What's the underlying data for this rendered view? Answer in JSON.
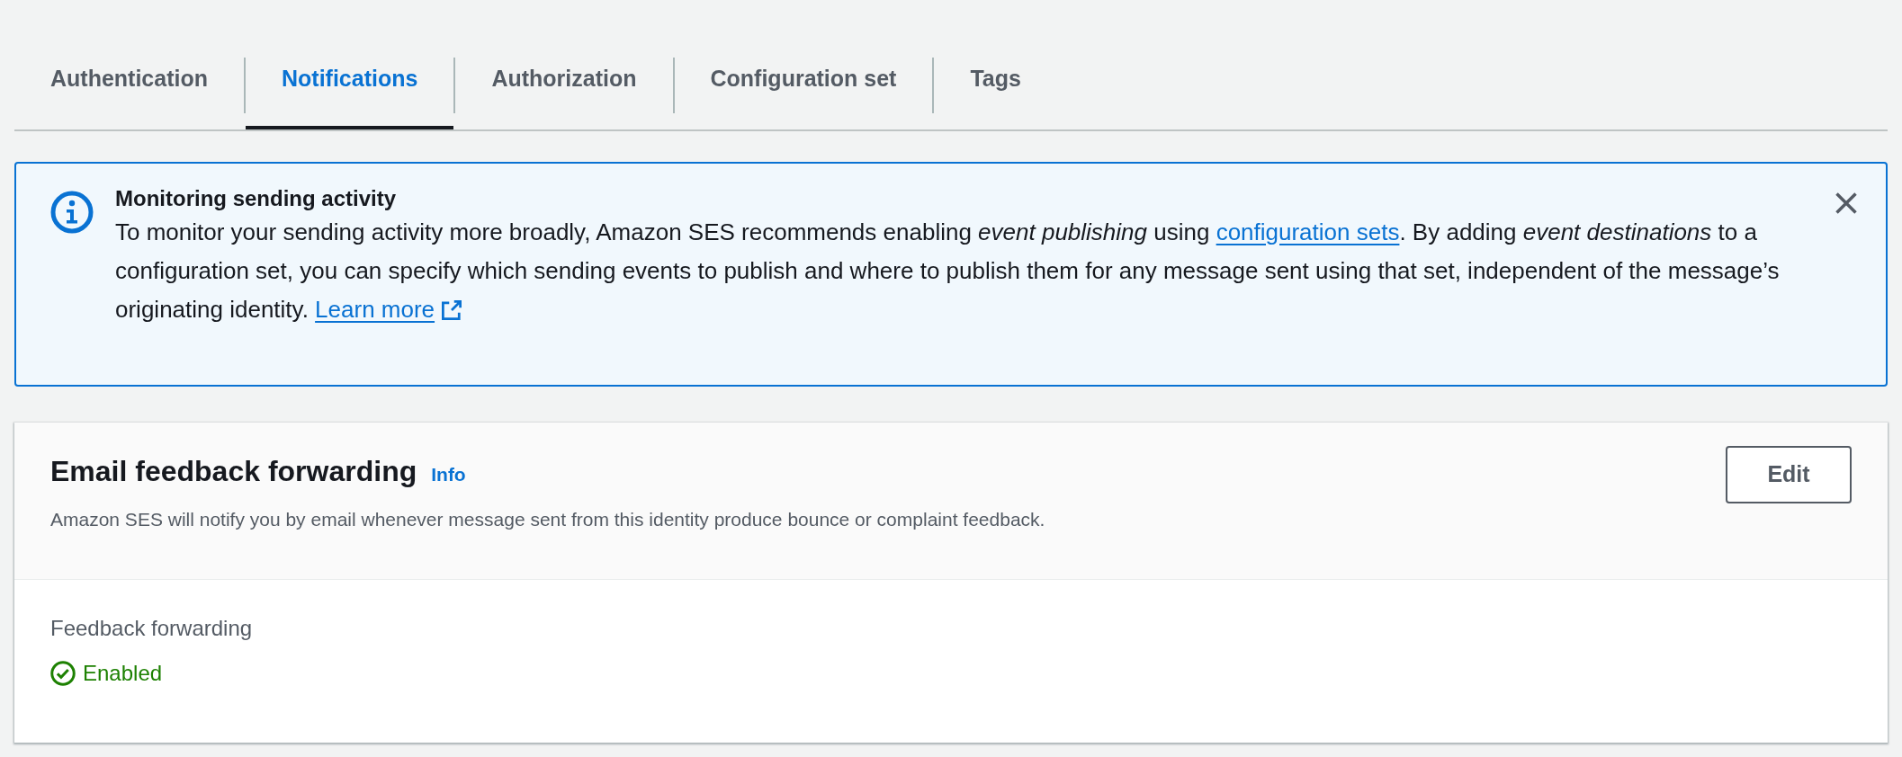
{
  "tabs": [
    {
      "label": "Authentication",
      "selected": false
    },
    {
      "label": "Notifications",
      "selected": true
    },
    {
      "label": "Authorization",
      "selected": false
    },
    {
      "label": "Configuration set",
      "selected": false
    },
    {
      "label": "Tags",
      "selected": false
    }
  ],
  "alert": {
    "title": "Monitoring sending activity",
    "message": [
      {
        "kind": "text",
        "text": "To monitor your sending activity more broadly, Amazon SES recommends enabling *event publishing* using "
      },
      {
        "kind": "link",
        "text": "configuration sets"
      },
      {
        "kind": "text",
        "text": ". By adding *event destinations* to a configuration set, you can specify which sending events to publish and where to publish them for any message sent using that set, independent of the message’s originating identity. "
      },
      {
        "kind": "external_link",
        "text": "Learn more"
      }
    ]
  },
  "card": {
    "title": "Email feedback forwarding",
    "info": "Info",
    "description": "Amazon SES will notify you by email whenever message sent from this identity produce bounce or complaint feedback.",
    "button": "Edit",
    "field_label": "Feedback forwarding",
    "status": {
      "text": "Enabled",
      "on": true
    }
  }
}
